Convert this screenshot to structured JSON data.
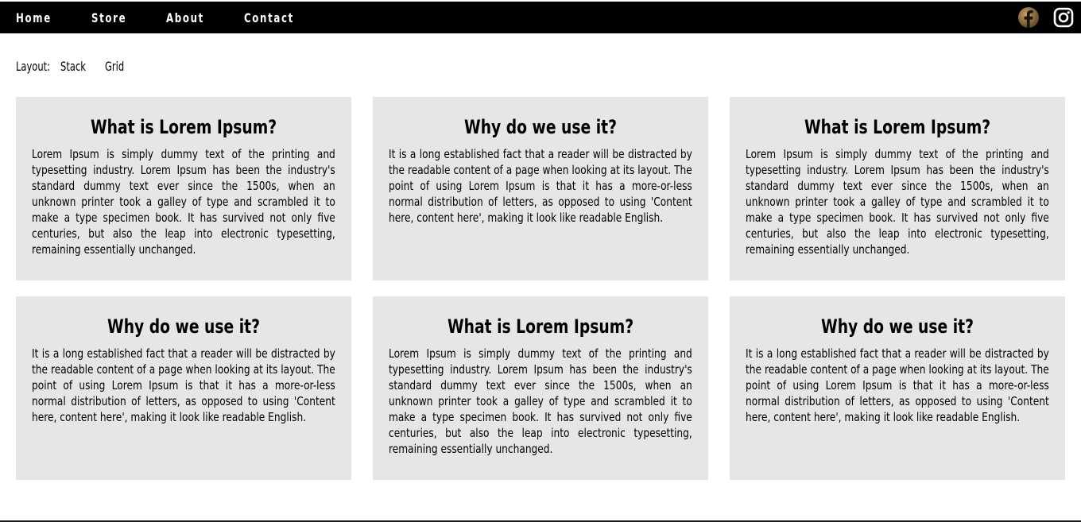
{
  "nav": {
    "links": [
      "Home",
      "Store",
      "About",
      "Contact"
    ]
  },
  "social": {
    "icons": [
      "facebook-icon",
      "instagram-icon"
    ]
  },
  "layout": {
    "label": "Layout:",
    "options": [
      "Stack",
      "Grid"
    ]
  },
  "cards": [
    {
      "title": "What is Lorem Ipsum?",
      "text": "Lorem Ipsum is simply dummy text of the printing and typesetting industry. Lorem Ipsum has been the industry's standard dummy text ever since the 1500s, when an unknown printer took a galley of type and scrambled it to make a type specimen book. It has survived not only five centuries, but also the leap into electronic typesetting, remaining essentially unchanged."
    },
    {
      "title": "Why do we use it?",
      "text": "It is a long established fact that a reader will be distracted by the readable content of a page when looking at its layout. The point of using Lorem Ipsum is that it has a more-or-less normal distribution of letters, as opposed to using 'Content here, content here', making it look like readable English."
    },
    {
      "title": "What is Lorem Ipsum?",
      "text": "Lorem Ipsum is simply dummy text of the printing and typesetting industry. Lorem Ipsum has been the industry's standard dummy text ever since the 1500s, when an unknown printer took a galley of type and scrambled it to make a type specimen book. It has survived not only five centuries, but also the leap into electronic typesetting, remaining essentially unchanged."
    },
    {
      "title": "Why do we use it?",
      "text": "It is a long established fact that a reader will be distracted by the readable content of a page when looking at its layout. The point of using Lorem Ipsum is that it has a more-or-less normal distribution of letters, as opposed to using 'Content here, content here', making it look like readable English."
    },
    {
      "title": "What is Lorem Ipsum?",
      "text": "Lorem Ipsum is simply dummy text of the printing and typesetting industry. Lorem Ipsum has been the industry's standard dummy text ever since the 1500s, when an unknown printer took a galley of type and scrambled it to make a type specimen book. It has survived not only five centuries, but also the leap into electronic typesetting, remaining essentially unchanged."
    },
    {
      "title": "Why do we use it?",
      "text": "It is a long established fact that a reader will be distracted by the readable content of a page when looking at its layout. The point of using Lorem Ipsum is that it has a more-or-less normal distribution of letters, as opposed to using 'Content here, content here', making it look like readable English."
    }
  ],
  "colors": {
    "navbar": "#000000",
    "card_background": "#e5e6e8",
    "facebook_icon": "#8a6a3a"
  }
}
